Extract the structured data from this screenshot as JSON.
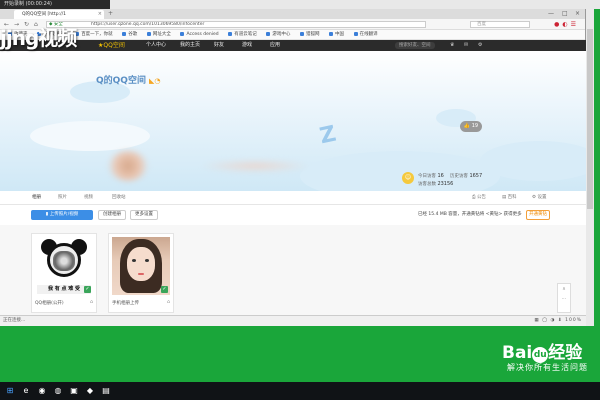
{
  "recording": {
    "label": "开始录制 (00:00:24)"
  },
  "watermark": {
    "top": "jjng视频"
  },
  "browser": {
    "tab_title": "Q的QQ空间 [http://1",
    "tab_close": "×",
    "new_tab": "+",
    "window_controls": [
      "—",
      "□",
      "×"
    ],
    "url": "https://user.qzone.qq.com/1013069580/infocenter",
    "search_placeholder": "百度",
    "bookmarks": [
      "收藏夹",
      "手机收藏夹",
      "百度一下，你就",
      "谷歌",
      "网址大全",
      "Access denied",
      "有道云笔记",
      "游戏中心",
      "猎狐网",
      "中国",
      "在线翻译"
    ],
    "status_text": "正在连接...",
    "status_right": "100%"
  },
  "qzone": {
    "nav": {
      "logo": "★QQ空间",
      "items": [
        "个人中心",
        "我的主页",
        "好友",
        "游戏",
        "应用"
      ],
      "search_placeholder": "搜索好友、空间",
      "right_items": [
        "♛",
        "✉",
        "⚙"
      ]
    },
    "space_title": "Q的QQ空间",
    "like_count": "👍 19",
    "stats": {
      "today_label": "今日访客",
      "today_value": "16",
      "total_label": "历史访客",
      "total_value": "1657",
      "collect_label": "访客总数",
      "collect_value": "23156"
    },
    "subtabs": [
      "相册",
      "照片",
      "视频",
      "回收站"
    ],
    "subtools": [
      "⎙ 公告",
      "▤ 百科",
      "⚙ 设置"
    ],
    "upload_label": "▮ 上传照片/视频",
    "create_album_label": "创建相册",
    "more_label": "更多设置",
    "capacity_text": "已经 15.4 MB 容量，开通黄钻将 <黄钻> 获得更多",
    "open_vip_label": "开通黄钻",
    "albums": [
      {
        "name": "QQ相册(公开)",
        "caption": "我 有 点 难 受",
        "lock": "⌂"
      },
      {
        "name": "手机相册上传",
        "lock": "⌂"
      }
    ],
    "side_tool": [
      "∧",
      "⋯"
    ]
  },
  "baidu": {
    "logo": "Bai",
    "paw": "du",
    "suffix": "经验",
    "slogan": "解决你所有生活问题"
  },
  "taskbar": {
    "icons": [
      "⊞",
      "e",
      "◉",
      "◍",
      "▣",
      "◆",
      "▤"
    ]
  },
  "colors": {
    "green_bg": "#1aa63a",
    "qzone_blue": "#3c8ee6",
    "vip_orange": "#f08a00"
  }
}
